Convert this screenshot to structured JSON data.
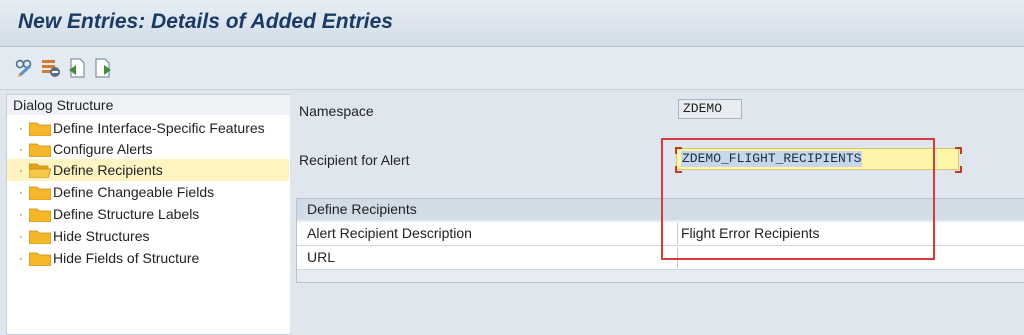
{
  "header": {
    "title": "New Entries: Details of Added Entries"
  },
  "toolbar": {
    "icons": [
      "glasses-edit-icon",
      "delete-row-icon",
      "previous-entry-icon",
      "next-entry-icon"
    ]
  },
  "dialog_structure": {
    "title": "Dialog Structure",
    "items": [
      {
        "label": "Define Interface-Specific Features",
        "selected": false
      },
      {
        "label": "Configure Alerts",
        "selected": false
      },
      {
        "label": "Define Recipients",
        "selected": true
      },
      {
        "label": "Define Changeable Fields",
        "selected": false
      },
      {
        "label": "Define Structure Labels",
        "selected": false
      },
      {
        "label": "Hide Structures",
        "selected": false
      },
      {
        "label": "Hide Fields of Structure",
        "selected": false
      }
    ]
  },
  "form": {
    "namespace_label": "Namespace",
    "namespace_value": "ZDEMO",
    "recipient_label": "Recipient for Alert",
    "recipient_value": "ZDEMO_FLIGHT_RECIPIENTS"
  },
  "recipients_group": {
    "title": "Define Recipients",
    "rows": [
      {
        "label": "Alert Recipient Description",
        "value": "Flight Error Recipients"
      },
      {
        "label": "URL",
        "value": ""
      }
    ]
  },
  "colors": {
    "highlight": "#d63b3b",
    "selected_row": "#fff5c2",
    "edit_field": "#fff4a8",
    "title_text": "#1b3a64"
  }
}
